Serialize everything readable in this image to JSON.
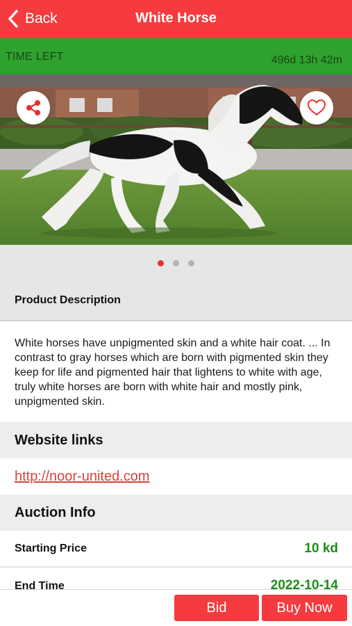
{
  "header": {
    "back_label": "Back",
    "title": "White Horse",
    "background_color": "#f53b3f"
  },
  "timer": {
    "label": "TIME LEFT",
    "value": "496d 13h 42m",
    "background_color": "#2ea22c"
  },
  "gallery": {
    "share_icon": "share-icon",
    "favorite_icon": "heart-icon",
    "page_count": 3,
    "active_page": 1
  },
  "description": {
    "header": "Product Description",
    "text": "White horses have unpigmented skin and a white hair coat. ... In contrast to gray horses which are born with pigmented skin they keep for life and pigmented hair that lightens to white with age, truly white horses are born with white hair and mostly pink, unpigmented skin."
  },
  "links": {
    "header": "Website links",
    "url": "http://noor-united.com"
  },
  "auction": {
    "header": "Auction Info",
    "rows": [
      {
        "label": "Starting Price",
        "value": "10 kd"
      },
      {
        "label": "End Time",
        "value": "2022-10-14"
      }
    ],
    "value_color": "#1e8c18"
  },
  "actions": {
    "bid_label": "Bid",
    "buy_label": "Buy Now"
  }
}
